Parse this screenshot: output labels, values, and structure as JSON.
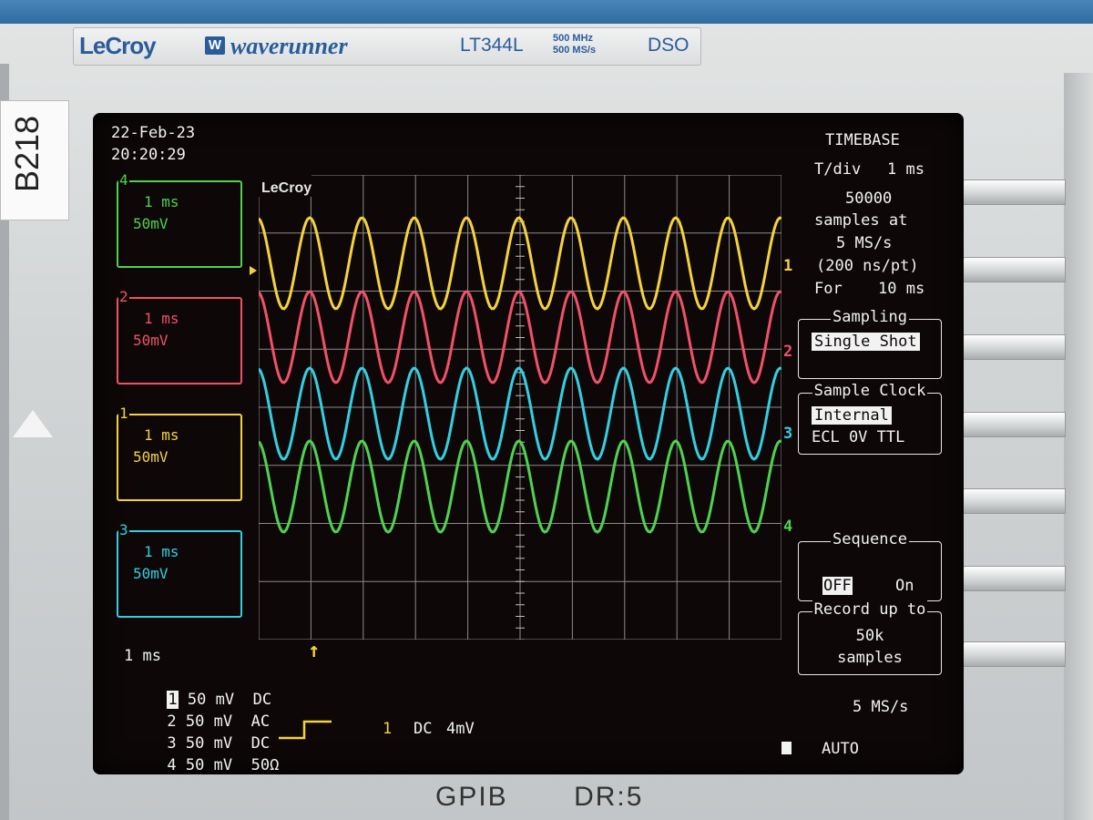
{
  "instrument": {
    "brand": "LeCroy",
    "logo": "W",
    "series": "waverunner",
    "model": "LT344L",
    "bandwidth": "500 MHz",
    "sample_rate_spec": "500 MS/s",
    "type": "DSO",
    "asset_label": "B218",
    "gpib_label": "GPIB",
    "gpib_addr": "DR:5"
  },
  "screen": {
    "date": "22-Feb-23",
    "time": "20:20:29",
    "grid_brand": "LeCroy",
    "channel_boxes": [
      {
        "num": "4",
        "tdiv": "1 ms",
        "vdiv": "50mV",
        "color": "#4fd24f"
      },
      {
        "num": "2",
        "tdiv": "1 ms",
        "vdiv": "50mV",
        "color": "#f2506a"
      },
      {
        "num": "1",
        "tdiv": "1 ms",
        "vdiv": "50mV",
        "color": "#f5d23c"
      },
      {
        "num": "3",
        "tdiv": "1 ms",
        "vdiv": "50mV",
        "color": "#33cfe0"
      }
    ],
    "timebase_summary": "1 ms",
    "channel_settings": [
      {
        "num": "1",
        "vdiv": "50 mV",
        "coupling": "DC"
      },
      {
        "num": "2",
        "vdiv": "50 mV",
        "coupling": "AC"
      },
      {
        "num": "3",
        "vdiv": "50 mV",
        "coupling": "DC"
      },
      {
        "num": "4",
        "vdiv": "50 mV",
        "coupling": "50Ω"
      }
    ],
    "trigger": {
      "source": "1",
      "coupling": "DC",
      "level": "4mV"
    },
    "traces": [
      {
        "label": "1",
        "color": "#f5d23c"
      },
      {
        "label": "2",
        "color": "#f2506a"
      },
      {
        "label": "3",
        "color": "#33cfe0"
      },
      {
        "label": "4",
        "color": "#4fd24f"
      }
    ]
  },
  "timebase_menu": {
    "title": "TIMEBASE",
    "tdiv_label": "T/div",
    "tdiv_value": "1 ms",
    "samples": "50000",
    "samples_at": "samples at",
    "rate": "5 MS/s",
    "per_point": "(200 ns/pt)",
    "for_label": "For",
    "for_value": "10 ms",
    "sampling_title": "Sampling",
    "sampling_value": "Single Shot",
    "clock_title": "Sample Clock",
    "clock_value": "Internal",
    "clock_options": "ECL 0V TTL",
    "sequence_title": "Sequence",
    "sequence_off": "OFF",
    "sequence_on": "On",
    "record_line1": "Record up to",
    "record_line2": "50k",
    "record_line3": "samples",
    "rate_footer": "5 MS/s",
    "trigger_mode": "AUTO"
  }
}
